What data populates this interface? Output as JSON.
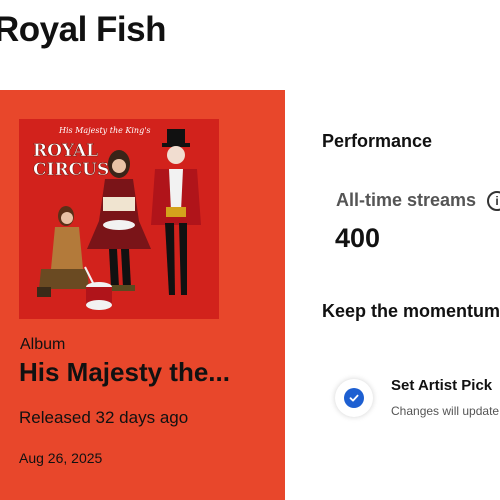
{
  "header": {
    "artist_name": "Royal Fish"
  },
  "release": {
    "cover_alt": "His Majesty the King's ROYAL CIRCUS",
    "cover_text": {
      "line1": "His Majesty the King's",
      "line2": "ROYAL",
      "line3": "CIRCUS"
    },
    "type": "Album",
    "title": "His Majesty the...",
    "released": "Released 32 days ago",
    "date": "Aug 26, 2025"
  },
  "performance": {
    "heading": "Performance",
    "streams_label": "All-time streams",
    "streams_info_icon": "info-icon",
    "streams_value": "400"
  },
  "momentum": {
    "heading": "Keep the momentum",
    "artist_pick": {
      "icon": "check-circle-icon",
      "title": "Set Artist Pick",
      "subtitle": "Changes will update"
    }
  },
  "colors": {
    "card_bg": "#e8472b",
    "check_blue": "#1d5fd1",
    "cover_bg": "#d8261f"
  }
}
